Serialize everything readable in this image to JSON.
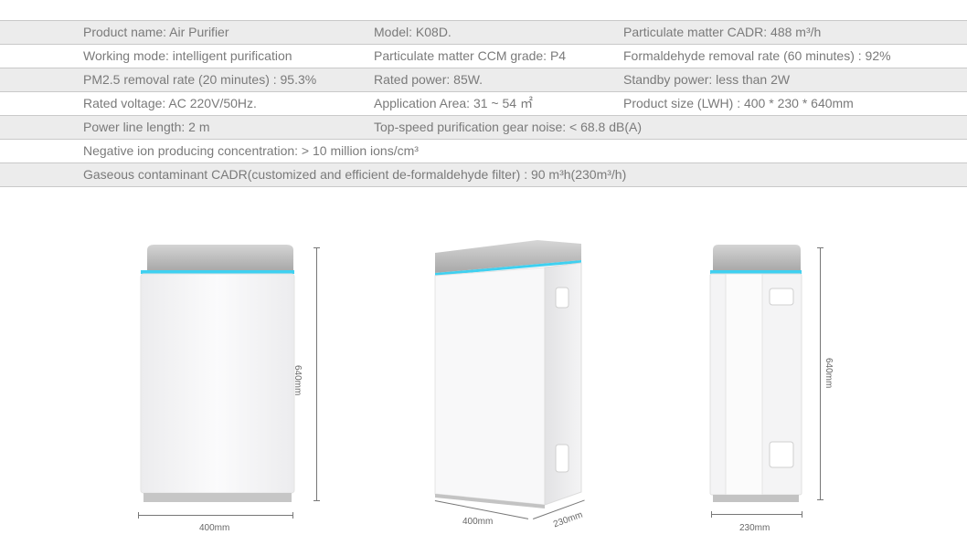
{
  "specs": [
    [
      "Product name: Air Purifier",
      "Model: K08D.",
      "Particulate matter CADR: 488 m³/h"
    ],
    [
      "Working mode: intelligent purification",
      "Particulate matter CCM grade: P4",
      "Formaldehyde removal rate (60 minutes) : 92%"
    ],
    [
      "PM2.5 removal rate (20 minutes) : 95.3%",
      "Rated power: 85W.",
      "Standby power: less than 2W"
    ],
    [
      "Rated voltage: AC 220V/50Hz.",
      "Application Area: 31 ~ 54 ㎡",
      "Product size (LWH) : 400 * 230 * 640mm"
    ],
    [
      "Power line length: 2 m",
      "Top-speed purification gear noise: < 68.8 dB(A)"
    ],
    [
      "Negative ion producing concentration: > 10 million ions/cm³"
    ],
    [
      "Gaseous contaminant CADR(customized and efficient de-formaldehyde filter) : 90 m³h(230m³/h)"
    ]
  ],
  "dimensions": {
    "front_width": "400mm",
    "front_height": "640mm",
    "angle_width": "400mm",
    "angle_depth": "230mm",
    "side_depth": "230mm",
    "side_height": "640mm"
  },
  "colors": {
    "accent_light": "#3fd0f0",
    "body": "#f7f7f8",
    "top_cap": "#bdbdbd"
  }
}
